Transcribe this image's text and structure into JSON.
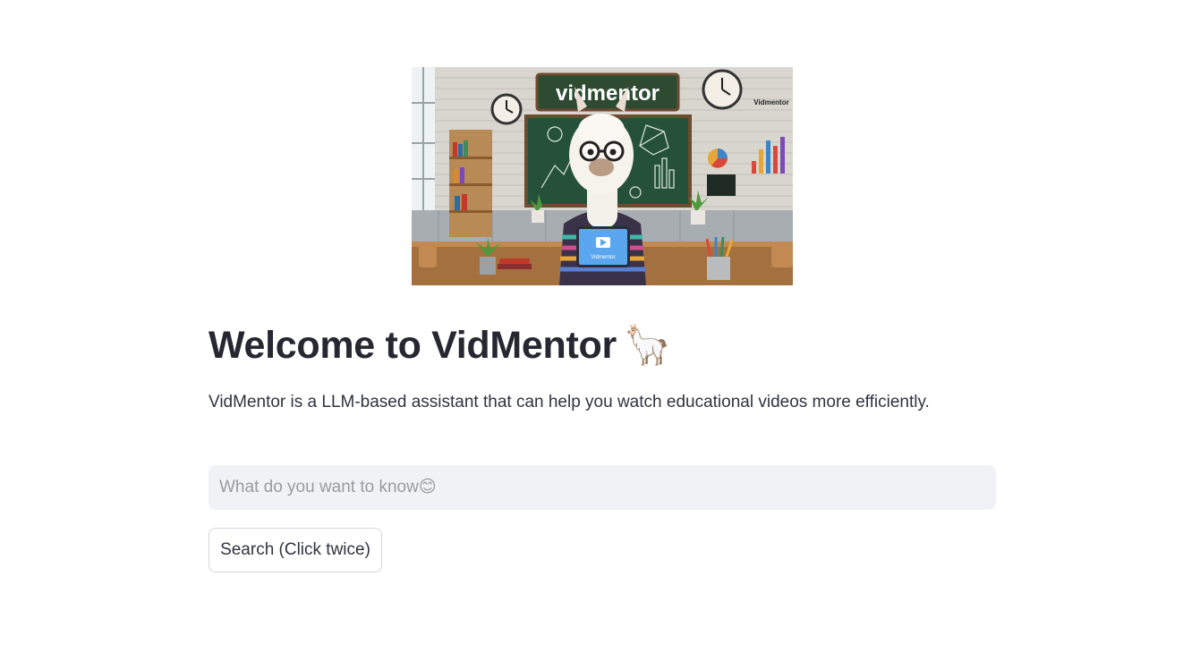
{
  "hero": {
    "image_alt": "Llama in glasses and striped sweater holding a tablet in a classroom",
    "sign_text": "vidmentor",
    "corner_text": "Vidmentor",
    "tablet_text": "Vidmentor"
  },
  "header": {
    "title": "Welcome to VidMentor",
    "title_emoji": "🦙"
  },
  "main": {
    "description": "VidMentor is a LLM-based assistant that can help you watch educational videos more efficiently."
  },
  "search": {
    "placeholder": "What do you want to know😊",
    "value": ""
  },
  "actions": {
    "search_label": "Search (Click twice)"
  }
}
